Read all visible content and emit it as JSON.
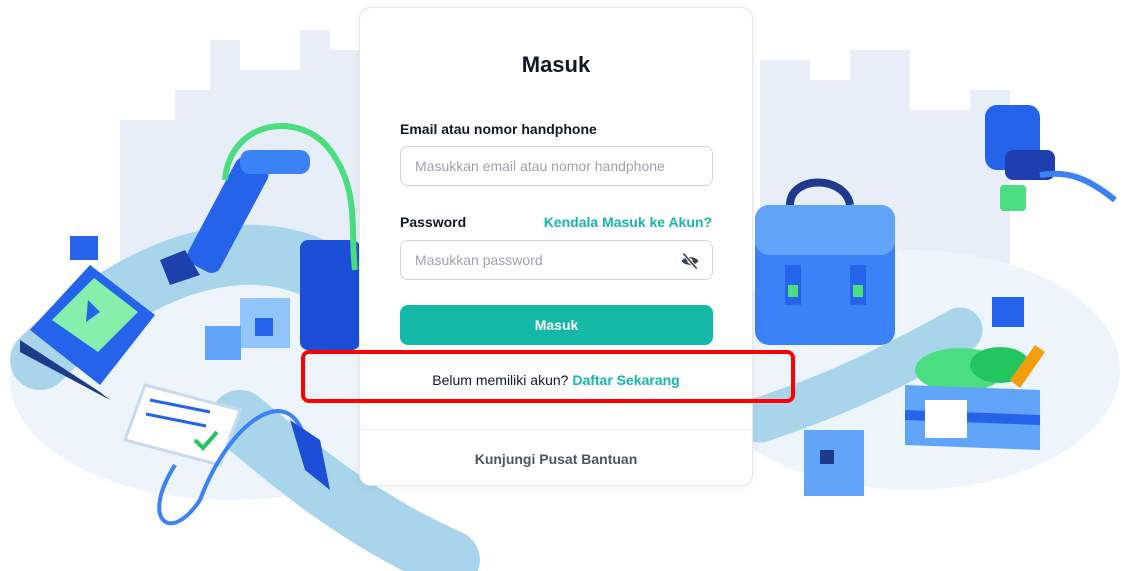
{
  "login": {
    "title": "Masuk",
    "email_label": "Email atau nomor handphone",
    "email_placeholder": "Masukkan email atau nomor handphone",
    "password_label": "Password",
    "forgot_link": "Kendala Masuk ke Akun?",
    "password_placeholder": "Masukkan password",
    "submit_label": "Masuk",
    "register_prompt": "Belum memiliki akun?",
    "register_link": "Daftar Sekarang",
    "help_center": "Kunjungi Pusat Bantuan"
  },
  "icons": {
    "password_toggle": "eye-off-icon"
  },
  "colors": {
    "accent": "#14b8a6",
    "highlight": "#ff0000",
    "illustration_blue": "#2563eb",
    "illustration_green": "#4ade80"
  }
}
